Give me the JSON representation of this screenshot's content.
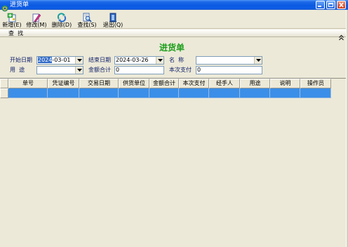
{
  "window": {
    "title": "进货单",
    "title_icon": "app-icon",
    "controls": [
      "minimize-icon",
      "maximize-icon",
      "close-icon"
    ]
  },
  "toolbar": {
    "items": [
      {
        "label": "新增(E)",
        "icon": "new-icon"
      },
      {
        "label": "修改(M)",
        "icon": "edit-icon"
      },
      {
        "label": "删除(D)",
        "icon": "delete-icon"
      },
      {
        "label": "查找(S)",
        "icon": "search-icon"
      },
      {
        "label": "退出(Q)",
        "icon": "exit-icon"
      }
    ]
  },
  "search_panel": {
    "label": "查  找",
    "toggle_icon": "collapse-chevron-icon"
  },
  "form": {
    "title": "进货单",
    "start_date": {
      "label": "开始日期",
      "value": "2024-03-01"
    },
    "end_date": {
      "label": "结束日期",
      "value": "2024-03-26"
    },
    "name": {
      "label": "名  称",
      "value": ""
    },
    "purpose": {
      "label": "用  途",
      "value": ""
    },
    "total_amount": {
      "label": "金额合计",
      "value": "0"
    },
    "payment": {
      "label": "本次支付",
      "value": "0"
    }
  },
  "grid": {
    "columns": [
      "单号",
      "凭证编号",
      "交易日期",
      "供货单位",
      "金额合计",
      "本次支付",
      "经手人",
      "用途",
      "说明",
      "操作员"
    ],
    "rows": [
      {
        "selected": true,
        "cells": [
          "",
          "",
          "",
          "",
          "",
          "",
          "",
          "",
          "",
          ""
        ]
      }
    ]
  },
  "colors": {
    "titlebar": "#0a5ae2",
    "form_title": "#1a9e1a",
    "selection": "#3b8fe8",
    "background": "#ece9d8"
  }
}
